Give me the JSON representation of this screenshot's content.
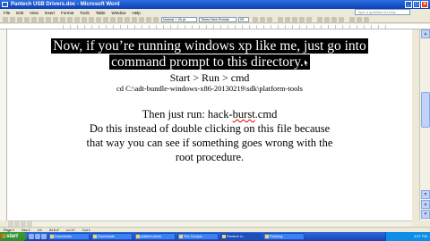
{
  "window": {
    "title": "Pantech USB Drivers.doc - Microsoft Word",
    "controls": [
      "_",
      "□",
      "×"
    ]
  },
  "menu": {
    "items": [
      "File",
      "Edit",
      "View",
      "Insert",
      "Format",
      "Tools",
      "Table",
      "Window",
      "Help"
    ],
    "help_placeholder": "Type a question for help"
  },
  "toolbar": {
    "style": "Normal + 29 pt",
    "font": "Times New Roman",
    "size": "29"
  },
  "document": {
    "line1": "Now, if you’re running windows xp like me, just go into",
    "line2": "command prompt to this directory.",
    "line3": "Start > Run > cmd",
    "line4": "cd C:\\adt-bundle-windows-x86-20130219\\sdk\\platform-tools",
    "line5_pre": "Then just run:  hack-",
    "line5_burst": "burst",
    "line5_post": ".cmd",
    "line6": "Do this instead of double clicking on this file because",
    "line7": "that way you can see if something goes wrong with the",
    "line8": "root procedure."
  },
  "status": {
    "page": "Page 1",
    "sec": "Sec 1",
    "pages": "1/1",
    "at": "At 6.4\"",
    "ln": "Ln 17",
    "col": "Col 1"
  },
  "taskbar": {
    "start": "start",
    "tasks": [
      "Downloads",
      "Downloads",
      "platform-tools",
      "The Compa...",
      "Pantech U...",
      "Flashing"
    ],
    "clock": "4:57 PM"
  },
  "colors": {
    "titlebar": "#0a3fb8",
    "highlight": "#000000",
    "taskbar": "#245dd7",
    "start": "#2f8c2f"
  }
}
